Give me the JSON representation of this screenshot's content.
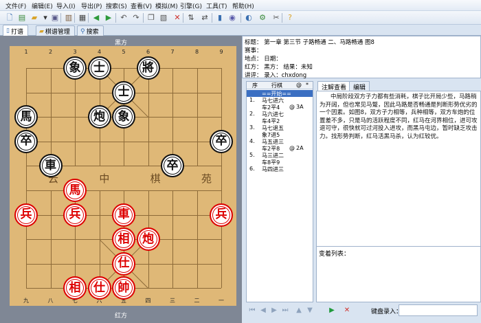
{
  "menu": [
    "文件(F)",
    "编辑(E)",
    "导入(I)",
    "导出(P)",
    "搜索(S)",
    "查看(V)",
    "模拟(M)",
    "引擎(G)",
    "工具(T)",
    "帮助(H)"
  ],
  "tabs": [
    "打谱",
    "棋谱管理",
    "搜索"
  ],
  "board": {
    "top_label": "黑方",
    "bottom_label": "红方",
    "top_coords": [
      "1",
      "2",
      "3",
      "4",
      "5",
      "6",
      "7",
      "8",
      "9"
    ],
    "bottom_coords": [
      "九",
      "八",
      "七",
      "六",
      "五",
      "四",
      "三",
      "二",
      "一"
    ],
    "river": [
      "云",
      "中",
      "棋",
      "苑"
    ],
    "pieces": [
      {
        "char": "象",
        "color": "black",
        "file": 3,
        "rank": 0
      },
      {
        "char": "士",
        "color": "black",
        "file": 4,
        "rank": 0
      },
      {
        "char": "將",
        "color": "black",
        "file": 6,
        "rank": 0
      },
      {
        "char": "士",
        "color": "black",
        "file": 5,
        "rank": 1
      },
      {
        "char": "炮",
        "color": "black",
        "file": 4,
        "rank": 2
      },
      {
        "char": "象",
        "color": "black",
        "file": 5,
        "rank": 2
      },
      {
        "char": "馬",
        "color": "black",
        "file": 1,
        "rank": 2
      },
      {
        "char": "卒",
        "color": "black",
        "file": 1,
        "rank": 3
      },
      {
        "char": "卒",
        "color": "black",
        "file": 9,
        "rank": 3
      },
      {
        "char": "車",
        "color": "black",
        "file": 2,
        "rank": 4
      },
      {
        "char": "卒",
        "color": "black",
        "file": 7,
        "rank": 4
      },
      {
        "char": "馬",
        "color": "red",
        "file": 3,
        "rank": 5
      },
      {
        "char": "兵",
        "color": "red",
        "file": 1,
        "rank": 6
      },
      {
        "char": "兵",
        "color": "red",
        "file": 3,
        "rank": 6
      },
      {
        "char": "車",
        "color": "red",
        "file": 5,
        "rank": 6
      },
      {
        "char": "兵",
        "color": "red",
        "file": 9,
        "rank": 6
      },
      {
        "char": "相",
        "color": "red",
        "file": 5,
        "rank": 7
      },
      {
        "char": "炮",
        "color": "red",
        "file": 6,
        "rank": 7
      },
      {
        "char": "仕",
        "color": "red",
        "file": 5,
        "rank": 8
      },
      {
        "char": "相",
        "color": "red",
        "file": 3,
        "rank": 9
      },
      {
        "char": "仕",
        "color": "red",
        "file": 4,
        "rank": 9
      },
      {
        "char": "帥",
        "color": "red",
        "file": 5,
        "rank": 9
      }
    ]
  },
  "info": {
    "title_line": "标题： 第一章 第三节 子路畅通 二、马路畅通 图8",
    "event_line": "赛事：",
    "place_line": "地点：          日期：",
    "players_line": "红方：          黑方：      结果：未知",
    "commentator_line": "讲评：        录入：chxdong"
  },
  "moves": {
    "headers": [
      "序",
      "行棋",
      "@",
      "*"
    ],
    "rows": [
      {
        "num": "",
        "move": "==开始==",
        "mark": "",
        "extra": ""
      },
      {
        "num": "1.",
        "move": "马七进六",
        "mark": "",
        "extra": ""
      },
      {
        "num": "",
        "move": "车2平4",
        "mark": "@",
        "extra": "3A"
      },
      {
        "num": "2.",
        "move": "马六进七",
        "mark": "",
        "extra": ""
      },
      {
        "num": "",
        "move": "车4平2",
        "mark": "",
        "extra": ""
      },
      {
        "num": "3.",
        "move": "马七退五",
        "mark": "",
        "extra": ""
      },
      {
        "num": "",
        "move": "象7进5",
        "mark": "",
        "extra": ""
      },
      {
        "num": "4.",
        "move": "马五进三",
        "mark": "",
        "extra": ""
      },
      {
        "num": "",
        "move": "车2平8",
        "mark": "@",
        "extra": "2A"
      },
      {
        "num": "5.",
        "move": "马三进二",
        "mark": "",
        "extra": ""
      },
      {
        "num": "",
        "move": "车8平9",
        "mark": "",
        "extra": ""
      },
      {
        "num": "6.",
        "move": "马四进三",
        "mark": "",
        "extra": ""
      }
    ]
  },
  "comment": {
    "tabs": [
      "注解查看",
      "编辑"
    ],
    "text": "中局阶段双方子力都有些消耗，棋子比开局少些，马路稍为开阔，但也常见马蹩，因此马路是否畅通是判断形势优劣的一个因素。如图8，双方子力相等，兵种相等，双方车炮的位置差不多，只是马的活跃程度不同，红马在河界相位，进可攻退可守，很快就可过河投入进攻，而黑马屯边，暂时缺乏攻击力。找形势判断，红马活黑马杀，认为红较优。",
    "variations_label": "变着列表："
  },
  "nav": {
    "buttons": [
      {
        "icon": "first",
        "glyph": "⏮",
        "color": "#8fa3bd"
      },
      {
        "icon": "prev",
        "glyph": "◀",
        "color": "#8fa3bd"
      },
      {
        "icon": "next",
        "glyph": "▶",
        "color": "#8fa3bd"
      },
      {
        "icon": "last",
        "glyph": "⏭",
        "color": "#8fa3bd"
      },
      {
        "icon": "up",
        "glyph": "▲",
        "color": "#8fa3bd"
      },
      {
        "icon": "down",
        "glyph": "▼",
        "color": "#8fa3bd"
      },
      {
        "icon": "play",
        "glyph": "▶",
        "color": "#1f9a3a"
      },
      {
        "icon": "stop",
        "glyph": "✕",
        "color": "#d0302b"
      }
    ],
    "keyboard_label": "键盘录入："
  },
  "toolbar_icons": [
    {
      "name": "new",
      "glyph": "🗋",
      "color": "#3a6fb0"
    },
    {
      "name": "open",
      "glyph": "▤",
      "color": "#3a8a3a"
    },
    {
      "name": "open-folder",
      "glyph": "▰",
      "color": "#d9a42a"
    },
    {
      "name": "dropdown",
      "glyph": "▾",
      "color": "#333"
    },
    {
      "name": "save",
      "glyph": "▣",
      "color": "#5a5a8a"
    },
    {
      "name": "paste",
      "glyph": "▥",
      "color": "#7a5a3a"
    },
    {
      "name": "delete",
      "glyph": "▦",
      "color": "#444"
    },
    {
      "name": "back",
      "glyph": "◀",
      "color": "#2e9a3a"
    },
    {
      "name": "forward",
      "glyph": "▶",
      "color": "#2e9a3a"
    },
    {
      "name": "undo",
      "glyph": "↶",
      "color": "#555"
    },
    {
      "name": "redo",
      "glyph": "↷",
      "color": "#555"
    },
    {
      "name": "copy",
      "glyph": "❐",
      "color": "#555"
    },
    {
      "name": "paste2",
      "glyph": "▧",
      "color": "#555"
    },
    {
      "name": "close",
      "glyph": "✕",
      "color": "#d0302b"
    },
    {
      "name": "flip-vertical",
      "glyph": "⇅",
      "color": "#444"
    },
    {
      "name": "flip-horizontal",
      "glyph": "⇄",
      "color": "#444"
    },
    {
      "name": "book",
      "glyph": "▮",
      "color": "#3a6fb0"
    },
    {
      "name": "engine",
      "glyph": "◉",
      "color": "#5a5aaa"
    },
    {
      "name": "analysis",
      "glyph": "◐",
      "color": "#3a6fb0"
    },
    {
      "name": "settings",
      "glyph": "⚙",
      "color": "#3a8a3a"
    },
    {
      "name": "cut",
      "glyph": "✂",
      "color": "#555"
    },
    {
      "name": "help",
      "glyph": "?",
      "color": "#d9a42a"
    }
  ]
}
